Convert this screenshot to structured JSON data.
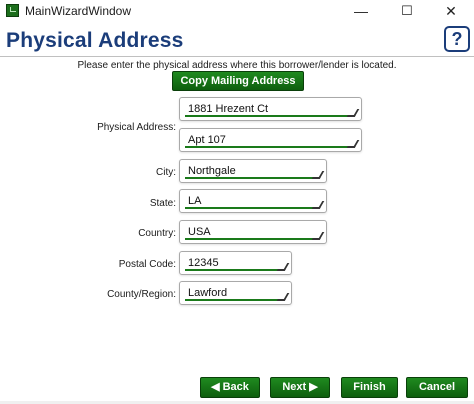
{
  "window": {
    "title": "MainWizardWindow",
    "minimize_glyph": "—",
    "maximize_glyph": "☐",
    "close_glyph": "✕"
  },
  "header": {
    "title": "Physical Address",
    "help_glyph": "?"
  },
  "instructions": "Please enter the physical address where this borrower/lender is located.",
  "copy_button_label": "Copy Mailing Address",
  "form": {
    "physical_address_label": "Physical Address:",
    "address_line1": "1881 Hrezent Ct",
    "address_line2": "Apt 107",
    "city_label": "City:",
    "city": "Northgale",
    "state_label": "State:",
    "state": "LA",
    "country_label": "Country:",
    "country": "USA",
    "postal_code_label": "Postal Code:",
    "postal_code": "12345",
    "county_label": "County/Region:",
    "county": "Lawford"
  },
  "nav": {
    "back_label": "◀ Back",
    "next_label": "Next ▶",
    "finish_label": "Finish",
    "cancel_label": "Cancel"
  },
  "colors": {
    "accent_green": "#0e5e0e",
    "title_blue": "#1b3d7a"
  }
}
